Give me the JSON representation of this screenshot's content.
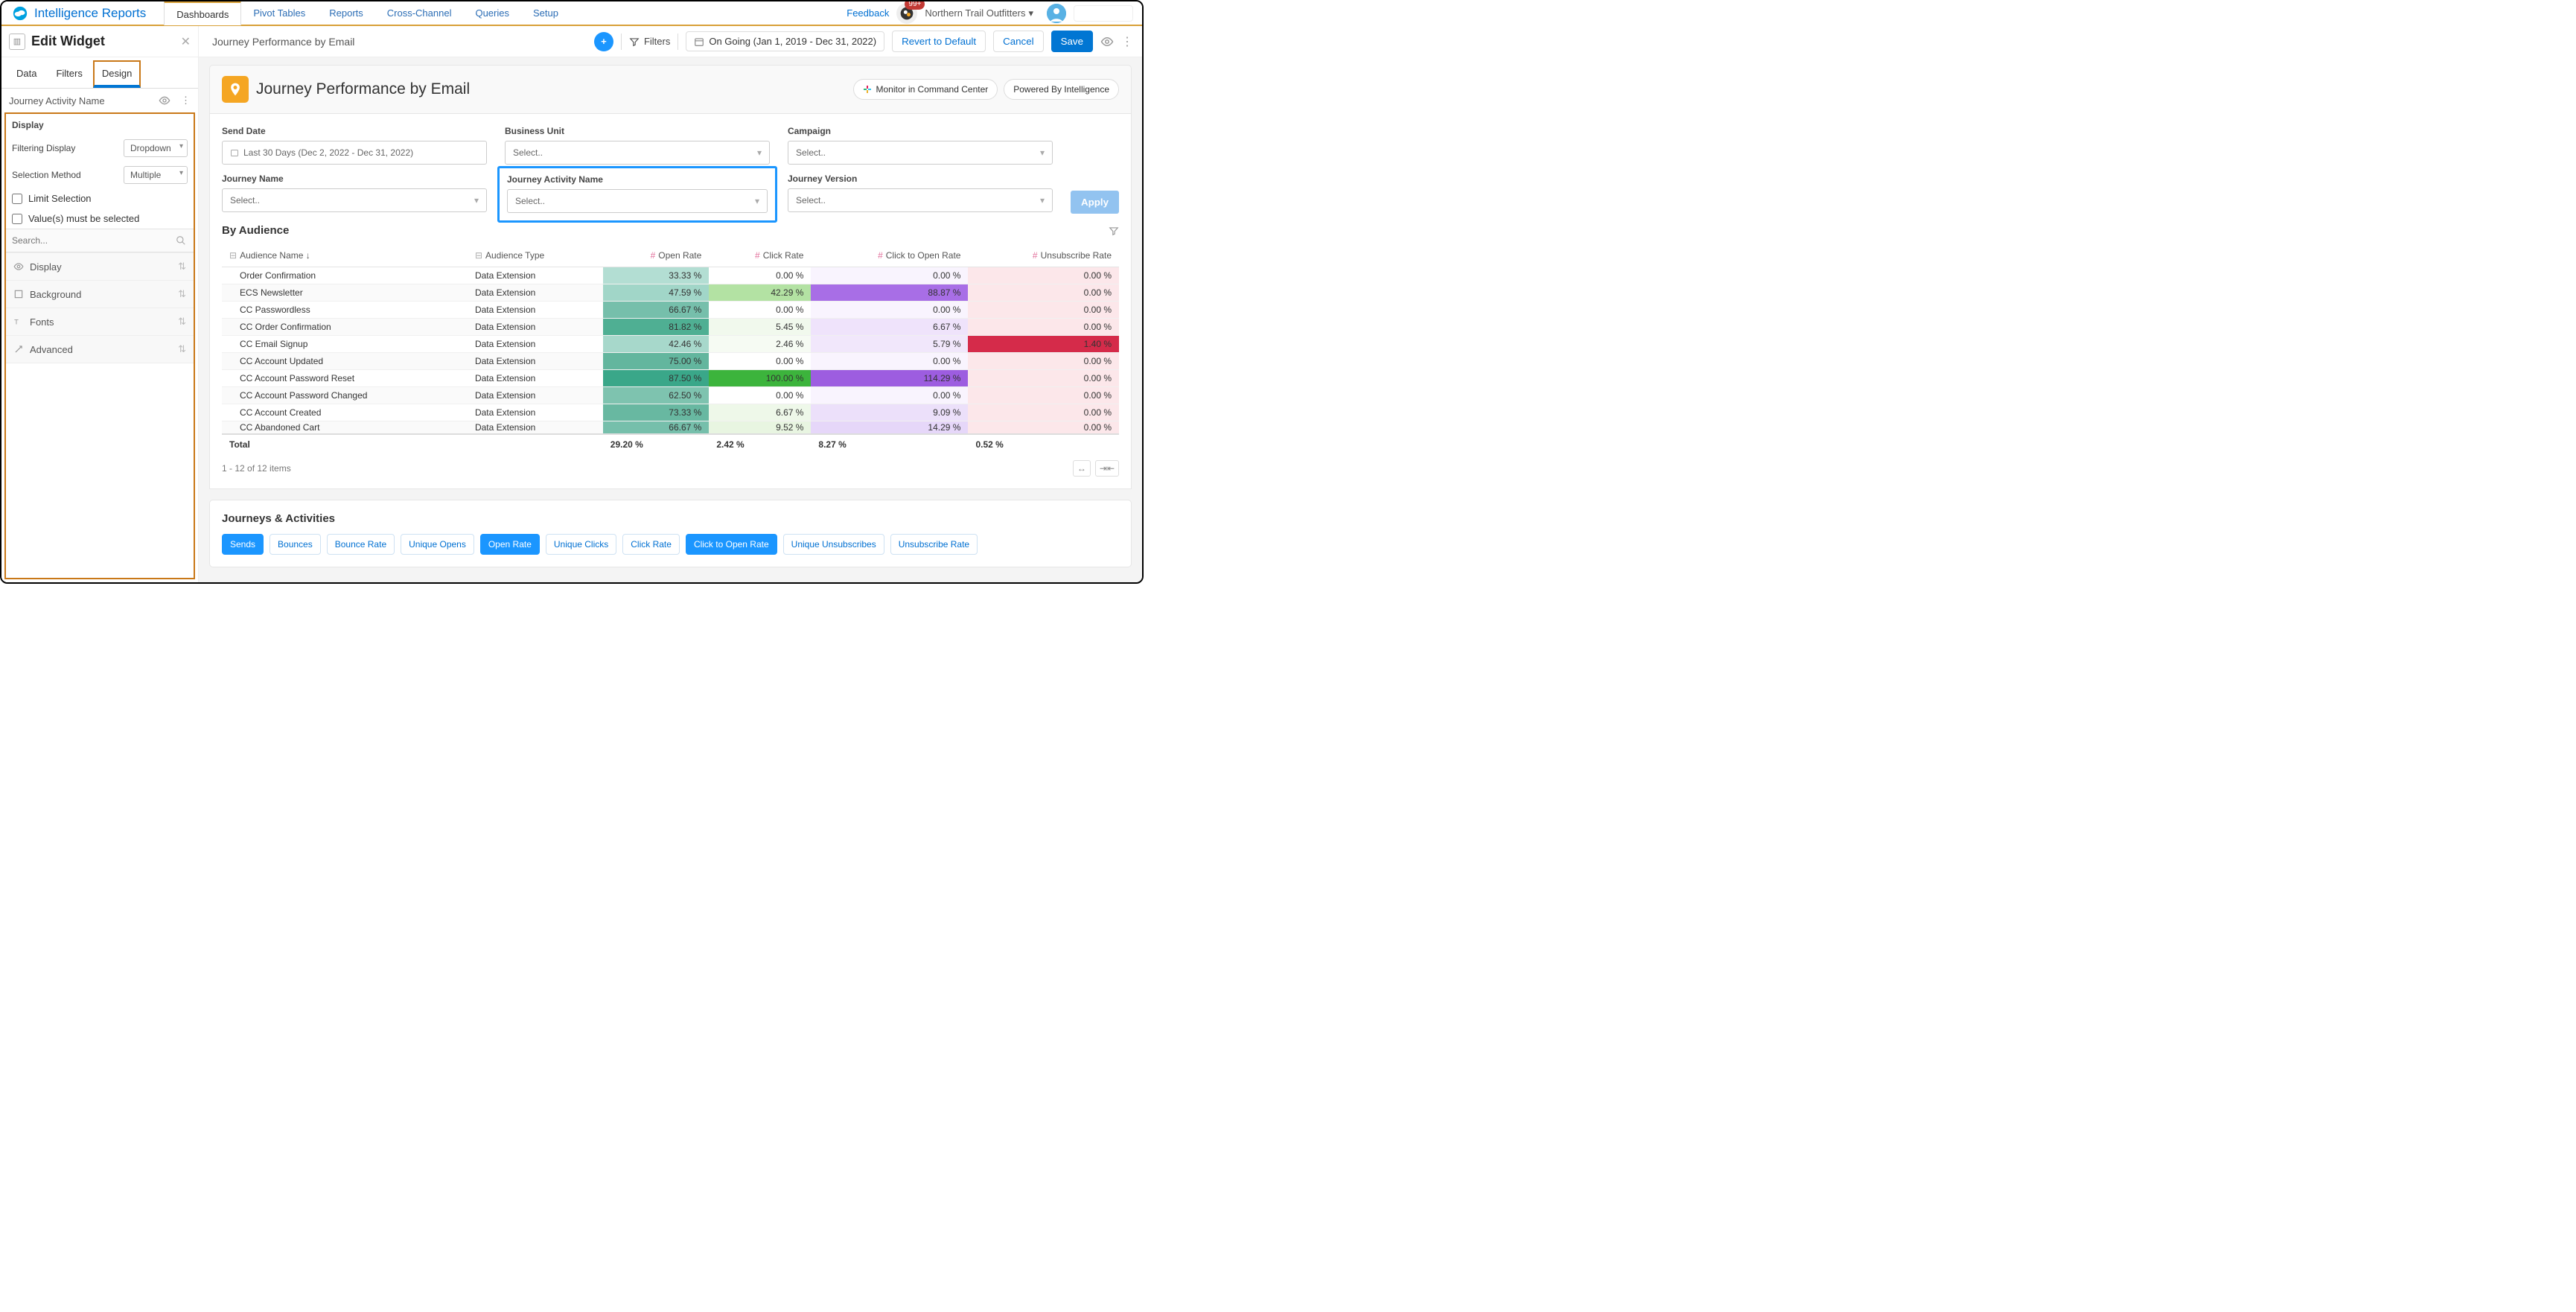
{
  "brand": "Intelligence Reports",
  "nav": {
    "tabs": [
      "Dashboards",
      "Pivot Tables",
      "Reports",
      "Cross-Channel",
      "Queries",
      "Setup"
    ],
    "activeIndex": 0,
    "feedback": "Feedback",
    "notifBadge": "99+",
    "org": "Northern Trail Outfitters"
  },
  "editor": {
    "title": "Edit Widget",
    "tabs": [
      "Data",
      "Filters",
      "Design"
    ],
    "activeTabIndex": 2,
    "widgetName": "Journey Activity Name",
    "displaySection": "Display",
    "filteringDisplayLabel": "Filtering Display",
    "filteringDisplayValue": "Dropdown",
    "selectionMethodLabel": "Selection Method",
    "selectionMethodValue": "Multiple",
    "limitSelectionLabel": "Limit Selection",
    "valuesMustLabel": "Value(s) must be selected",
    "searchPlaceholder": "Search...",
    "accordions": [
      "Display",
      "Background",
      "Fonts",
      "Advanced"
    ]
  },
  "toolbar": {
    "breadcrumbTitle": "Journey Performance by Email",
    "filtersLabel": "Filters",
    "dateRange": "On Going (Jan 1, 2019 - Dec 31, 2022)",
    "revert": "Revert to Default",
    "cancel": "Cancel",
    "save": "Save"
  },
  "header": {
    "title": "Journey Performance by Email",
    "monitor": "Monitor in Command Center",
    "powered": "Powered By Intelligence"
  },
  "filters": {
    "sendDate": {
      "label": "Send Date",
      "value": "Last 30 Days (Dec 2, 2022 - Dec 31, 2022)"
    },
    "businessUnit": {
      "label": "Business Unit",
      "value": "Select.."
    },
    "campaign": {
      "label": "Campaign",
      "value": "Select.."
    },
    "journeyName": {
      "label": "Journey Name",
      "value": "Select.."
    },
    "journeyActivityName": {
      "label": "Journey Activity Name",
      "value": "Select.."
    },
    "journeyVersion": {
      "label": "Journey Version",
      "value": "Select.."
    },
    "applyLabel": "Apply"
  },
  "table": {
    "sectionTitle": "By Audience",
    "columns": [
      "Audience Name",
      "Audience Type",
      "Open Rate",
      "Click Rate",
      "Click to Open Rate",
      "Unsubscribe Rate"
    ],
    "rows": [
      {
        "name": "Order Confirmation",
        "type": "Data Extension",
        "open": "33.33 %",
        "click": "0.00 %",
        "cto": "0.00 %",
        "unsub": "0.00 %",
        "c": {
          "open": "#b3ded3",
          "click": "#ffffff",
          "cto": "#f9f4fe",
          "unsub": "#fce7ea"
        }
      },
      {
        "name": "ECS Newsletter",
        "type": "Data Extension",
        "open": "47.59 %",
        "click": "42.29 %",
        "cto": "88.87 %",
        "unsub": "0.00 %",
        "c": {
          "open": "#a1d6c8",
          "click": "#b3e2a3",
          "cto": "#a86ee6",
          "unsub": "#fce7ea"
        }
      },
      {
        "name": "CC Passwordless",
        "type": "Data Extension",
        "open": "66.67 %",
        "click": "0.00 %",
        "cto": "0.00 %",
        "unsub": "0.00 %",
        "c": {
          "open": "#76bfab",
          "click": "#ffffff",
          "cto": "#f9f4fe",
          "unsub": "#fce7ea"
        }
      },
      {
        "name": "CC Order Confirmation",
        "type": "Data Extension",
        "open": "81.82 %",
        "click": "5.45 %",
        "cto": "6.67 %",
        "unsub": "0.00 %",
        "c": {
          "open": "#4faf93",
          "click": "#f1f9ed",
          "cto": "#efe3fb",
          "unsub": "#fce7ea"
        }
      },
      {
        "name": "CC Email Signup",
        "type": "Data Extension",
        "open": "42.46 %",
        "click": "2.46 %",
        "cto": "5.79 %",
        "unsub": "1.40 %",
        "c": {
          "open": "#a7d8cb",
          "click": "#f6fbf3",
          "cto": "#f1e7fb",
          "unsub": "#d52b4a"
        }
      },
      {
        "name": "CC Account Updated",
        "type": "Data Extension",
        "open": "75.00 %",
        "click": "0.00 %",
        "cto": "0.00 %",
        "unsub": "0.00 %",
        "c": {
          "open": "#63b69e",
          "click": "#ffffff",
          "cto": "#f9f4fe",
          "unsub": "#fce7ea"
        }
      },
      {
        "name": "CC Account Password Reset",
        "type": "Data Extension",
        "open": "87.50 %",
        "click": "100.00 %",
        "cto": "114.29 %",
        "unsub": "0.00 %",
        "c": {
          "open": "#3aa789",
          "click": "#3cb43c",
          "cto": "#9d5de0",
          "unsub": "#fce7ea"
        }
      },
      {
        "name": "CC Account Password Changed",
        "type": "Data Extension",
        "open": "62.50 %",
        "click": "0.00 %",
        "cto": "0.00 %",
        "unsub": "0.00 %",
        "c": {
          "open": "#7ec3af",
          "click": "#ffffff",
          "cto": "#f9f4fe",
          "unsub": "#fce7ea"
        }
      },
      {
        "name": "CC Account Created",
        "type": "Data Extension",
        "open": "73.33 %",
        "click": "6.67 %",
        "cto": "9.09 %",
        "unsub": "0.00 %",
        "c": {
          "open": "#68b8a1",
          "click": "#eef8e9",
          "cto": "#ece0fa",
          "unsub": "#fce7ea"
        }
      },
      {
        "name": "CC Abandoned Cart",
        "type": "Data Extension",
        "open": "66.67 %",
        "click": "9.52 %",
        "cto": "14.29 %",
        "unsub": "0.00 %",
        "c": {
          "open": "#76bfab",
          "click": "#e8f5e1",
          "cto": "#e6d7f9",
          "unsub": "#fce7ea"
        }
      }
    ],
    "totals": {
      "label": "Total",
      "open": "29.20 %",
      "click": "2.42 %",
      "cto": "8.27 %",
      "unsub": "0.52 %"
    },
    "pager": "1 - 12 of 12 items"
  },
  "journeys": {
    "title": "Journeys & Activities",
    "pills": [
      "Sends",
      "Bounces",
      "Bounce Rate",
      "Unique Opens",
      "Open Rate",
      "Unique Clicks",
      "Click Rate",
      "Click to Open Rate",
      "Unique Unsubscribes",
      "Unsubscribe Rate"
    ],
    "activeIndexes": [
      0,
      4,
      7
    ]
  }
}
